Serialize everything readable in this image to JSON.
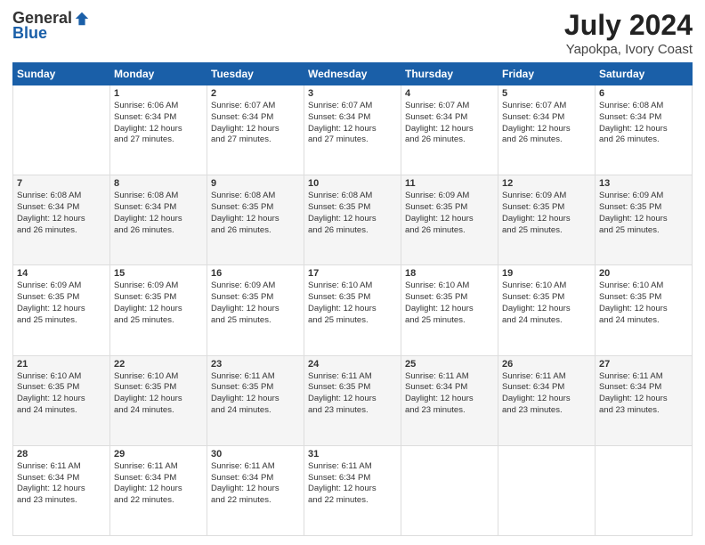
{
  "header": {
    "logo_general": "General",
    "logo_blue": "Blue",
    "month_year": "July 2024",
    "location": "Yapokpa, Ivory Coast"
  },
  "weekdays": [
    "Sunday",
    "Monday",
    "Tuesday",
    "Wednesday",
    "Thursday",
    "Friday",
    "Saturday"
  ],
  "weeks": [
    [
      {
        "day": "",
        "info": ""
      },
      {
        "day": "1",
        "info": "Sunrise: 6:06 AM\nSunset: 6:34 PM\nDaylight: 12 hours\nand 27 minutes."
      },
      {
        "day": "2",
        "info": "Sunrise: 6:07 AM\nSunset: 6:34 PM\nDaylight: 12 hours\nand 27 minutes."
      },
      {
        "day": "3",
        "info": "Sunrise: 6:07 AM\nSunset: 6:34 PM\nDaylight: 12 hours\nand 27 minutes."
      },
      {
        "day": "4",
        "info": "Sunrise: 6:07 AM\nSunset: 6:34 PM\nDaylight: 12 hours\nand 26 minutes."
      },
      {
        "day": "5",
        "info": "Sunrise: 6:07 AM\nSunset: 6:34 PM\nDaylight: 12 hours\nand 26 minutes."
      },
      {
        "day": "6",
        "info": "Sunrise: 6:08 AM\nSunset: 6:34 PM\nDaylight: 12 hours\nand 26 minutes."
      }
    ],
    [
      {
        "day": "7",
        "info": "Sunrise: 6:08 AM\nSunset: 6:34 PM\nDaylight: 12 hours\nand 26 minutes."
      },
      {
        "day": "8",
        "info": "Sunrise: 6:08 AM\nSunset: 6:34 PM\nDaylight: 12 hours\nand 26 minutes."
      },
      {
        "day": "9",
        "info": "Sunrise: 6:08 AM\nSunset: 6:35 PM\nDaylight: 12 hours\nand 26 minutes."
      },
      {
        "day": "10",
        "info": "Sunrise: 6:08 AM\nSunset: 6:35 PM\nDaylight: 12 hours\nand 26 minutes."
      },
      {
        "day": "11",
        "info": "Sunrise: 6:09 AM\nSunset: 6:35 PM\nDaylight: 12 hours\nand 26 minutes."
      },
      {
        "day": "12",
        "info": "Sunrise: 6:09 AM\nSunset: 6:35 PM\nDaylight: 12 hours\nand 25 minutes."
      },
      {
        "day": "13",
        "info": "Sunrise: 6:09 AM\nSunset: 6:35 PM\nDaylight: 12 hours\nand 25 minutes."
      }
    ],
    [
      {
        "day": "14",
        "info": "Sunrise: 6:09 AM\nSunset: 6:35 PM\nDaylight: 12 hours\nand 25 minutes."
      },
      {
        "day": "15",
        "info": "Sunrise: 6:09 AM\nSunset: 6:35 PM\nDaylight: 12 hours\nand 25 minutes."
      },
      {
        "day": "16",
        "info": "Sunrise: 6:09 AM\nSunset: 6:35 PM\nDaylight: 12 hours\nand 25 minutes."
      },
      {
        "day": "17",
        "info": "Sunrise: 6:10 AM\nSunset: 6:35 PM\nDaylight: 12 hours\nand 25 minutes."
      },
      {
        "day": "18",
        "info": "Sunrise: 6:10 AM\nSunset: 6:35 PM\nDaylight: 12 hours\nand 25 minutes."
      },
      {
        "day": "19",
        "info": "Sunrise: 6:10 AM\nSunset: 6:35 PM\nDaylight: 12 hours\nand 24 minutes."
      },
      {
        "day": "20",
        "info": "Sunrise: 6:10 AM\nSunset: 6:35 PM\nDaylight: 12 hours\nand 24 minutes."
      }
    ],
    [
      {
        "day": "21",
        "info": "Sunrise: 6:10 AM\nSunset: 6:35 PM\nDaylight: 12 hours\nand 24 minutes."
      },
      {
        "day": "22",
        "info": "Sunrise: 6:10 AM\nSunset: 6:35 PM\nDaylight: 12 hours\nand 24 minutes."
      },
      {
        "day": "23",
        "info": "Sunrise: 6:11 AM\nSunset: 6:35 PM\nDaylight: 12 hours\nand 24 minutes."
      },
      {
        "day": "24",
        "info": "Sunrise: 6:11 AM\nSunset: 6:35 PM\nDaylight: 12 hours\nand 23 minutes."
      },
      {
        "day": "25",
        "info": "Sunrise: 6:11 AM\nSunset: 6:34 PM\nDaylight: 12 hours\nand 23 minutes."
      },
      {
        "day": "26",
        "info": "Sunrise: 6:11 AM\nSunset: 6:34 PM\nDaylight: 12 hours\nand 23 minutes."
      },
      {
        "day": "27",
        "info": "Sunrise: 6:11 AM\nSunset: 6:34 PM\nDaylight: 12 hours\nand 23 minutes."
      }
    ],
    [
      {
        "day": "28",
        "info": "Sunrise: 6:11 AM\nSunset: 6:34 PM\nDaylight: 12 hours\nand 23 minutes."
      },
      {
        "day": "29",
        "info": "Sunrise: 6:11 AM\nSunset: 6:34 PM\nDaylight: 12 hours\nand 22 minutes."
      },
      {
        "day": "30",
        "info": "Sunrise: 6:11 AM\nSunset: 6:34 PM\nDaylight: 12 hours\nand 22 minutes."
      },
      {
        "day": "31",
        "info": "Sunrise: 6:11 AM\nSunset: 6:34 PM\nDaylight: 12 hours\nand 22 minutes."
      },
      {
        "day": "",
        "info": ""
      },
      {
        "day": "",
        "info": ""
      },
      {
        "day": "",
        "info": ""
      }
    ]
  ]
}
